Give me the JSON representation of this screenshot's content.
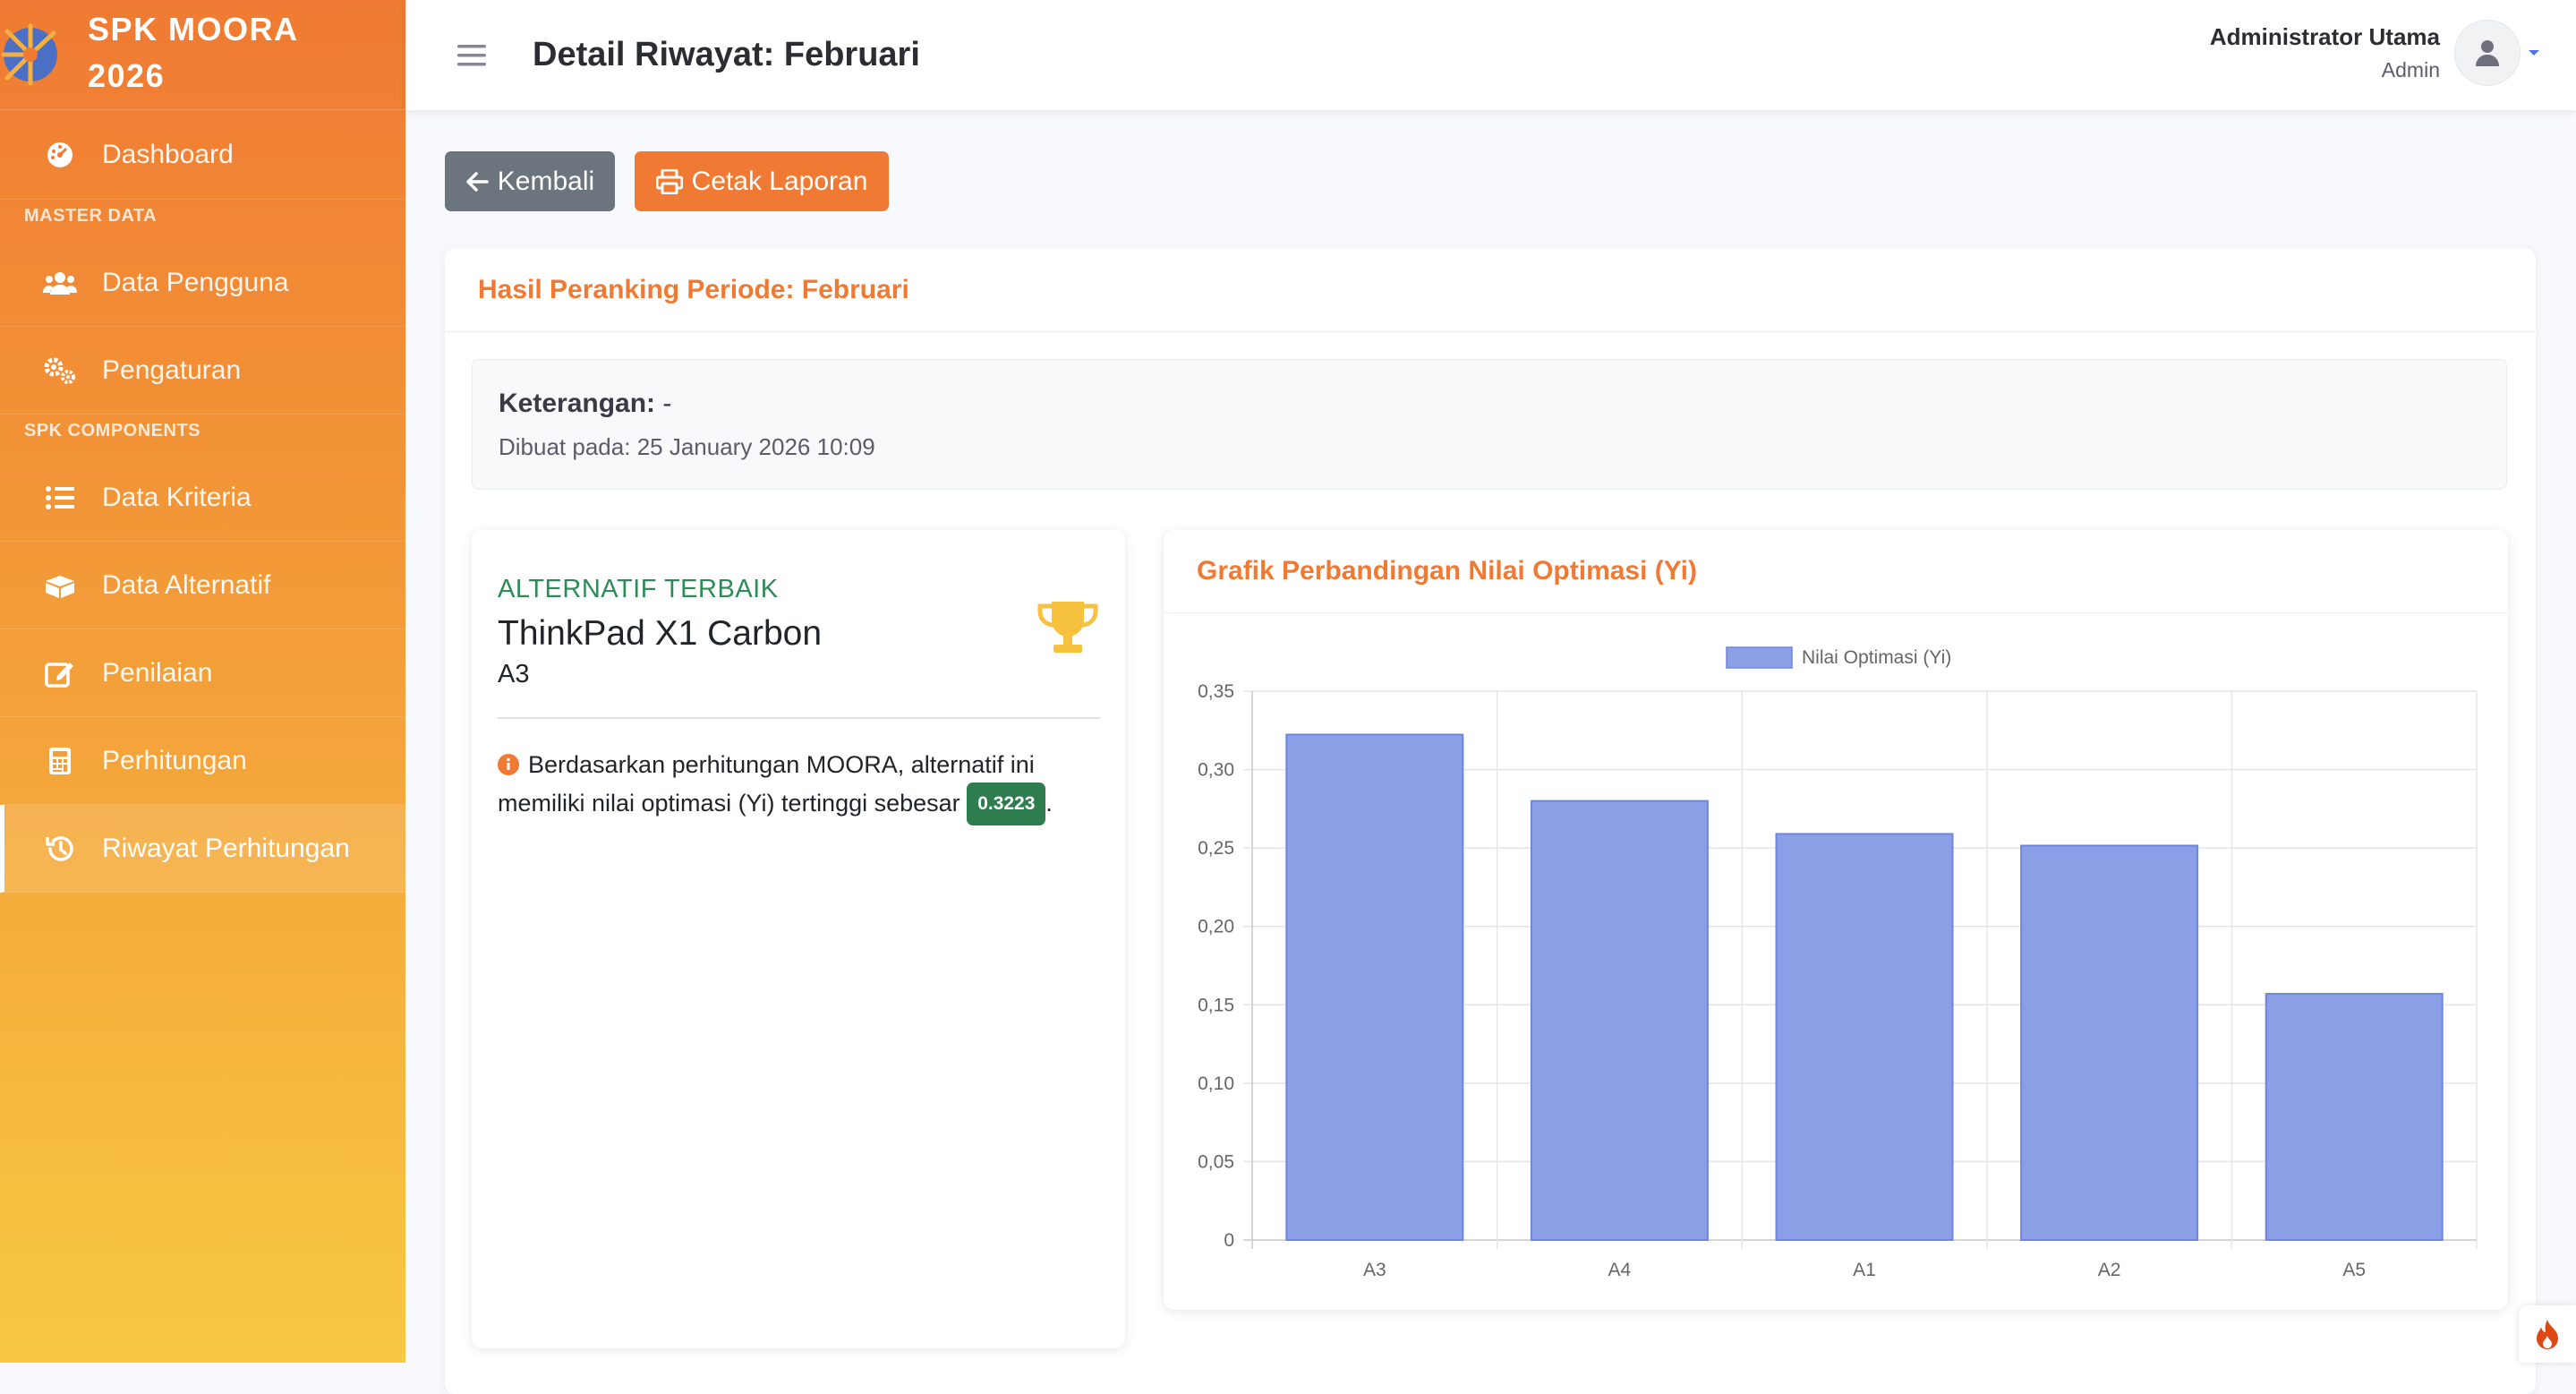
{
  "sidebar": {
    "brand_line1": "SPK MOORA",
    "brand_line2": "2026",
    "dashboard": "Dashboard",
    "heading_master": "MASTER DATA",
    "data_pengguna": "Data Pengguna",
    "pengaturan": "Pengaturan",
    "heading_spk": "SPK COMPONENTS",
    "data_kriteria": "Data Kriteria",
    "data_alternatif": "Data Alternatif",
    "penilaian": "Penilaian",
    "perhitungan": "Perhitungan",
    "riwayat": "Riwayat Perhitungan",
    "active_item": "Riwayat Perhitungan"
  },
  "topbar": {
    "title": "Detail Riwayat: Februari",
    "user_name": "Administrator Utama",
    "user_role": "Admin"
  },
  "buttons": {
    "back": "Kembali",
    "print": "Cetak Laporan"
  },
  "main": {
    "header": "Hasil Peranking Periode: Februari",
    "keterangan_label": "Keterangan:",
    "keterangan_value": "-",
    "dibuat_label": "Dibuat pada:",
    "dibuat_value": "25 January 2026 10:09"
  },
  "best": {
    "label": "ALTERNATIF TERBAIK",
    "name": "ThinkPad X1 Carbon",
    "code": "A3",
    "desc_before": "Berdasarkan perhitungan MOORA, alternatif ini memiliki nilai optimasi (Yi) tertinggi sebesar",
    "score": "0.3223",
    "desc_after": "."
  },
  "chart_card": {
    "title": "Grafik Perbandingan Nilai Optimasi (Yi)"
  },
  "colors": {
    "accent": "#f07a33",
    "bar_fill": "#8a9fe5",
    "bar_stroke": "#6f86de",
    "success": "#2e7d4f"
  },
  "chart_data": {
    "type": "bar",
    "categories": [
      "A3",
      "A4",
      "A1",
      "A2",
      "A5"
    ],
    "series": [
      {
        "name": "Nilai Optimasi (Yi)",
        "values": [
          0.3223,
          0.28,
          0.259,
          0.2515,
          0.157
        ]
      }
    ],
    "ylim": [
      0,
      0.35
    ],
    "yticks": [
      "0",
      "0,05",
      "0,10",
      "0,15",
      "0,20",
      "0,25",
      "0,30",
      "0,35"
    ],
    "legend": "top-center",
    "grid": true
  }
}
